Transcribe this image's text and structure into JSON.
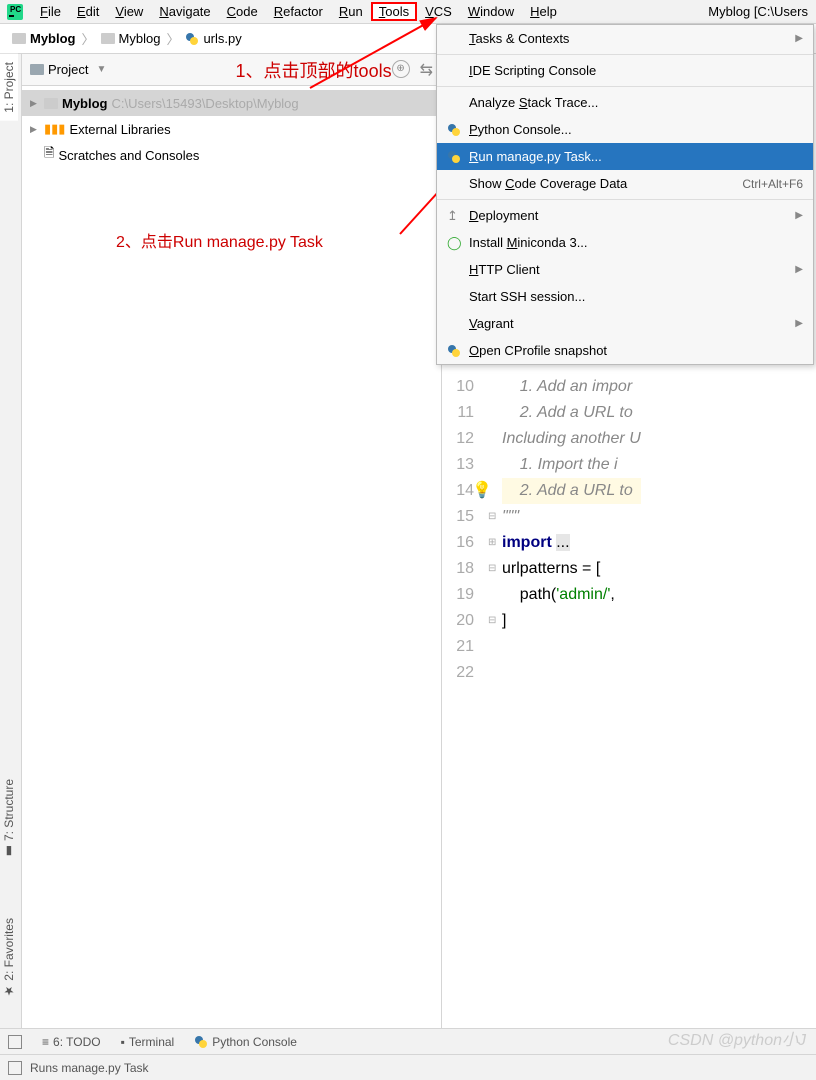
{
  "menubar": {
    "items": [
      "File",
      "Edit",
      "View",
      "Navigate",
      "Code",
      "Refactor",
      "Run",
      "Tools",
      "VCS",
      "Window",
      "Help"
    ],
    "right_title": "Myblog [C:\\Users"
  },
  "breadcrumb": {
    "items": [
      "Myblog",
      "Myblog",
      "urls.py"
    ]
  },
  "annotations": {
    "a1": "1、点击顶部的tools",
    "a2": "2、点击Run manage.py Task"
  },
  "project_panel": {
    "title": "Project",
    "tree": [
      {
        "label": "Myblog",
        "path": "C:\\Users\\15493\\Desktop\\Myblog",
        "selected": true,
        "arrow": "▶",
        "icon": "folder"
      },
      {
        "label": "External Libraries",
        "arrow": "▶",
        "icon": "lib"
      },
      {
        "label": "Scratches and Consoles",
        "arrow": "",
        "icon": "scratch"
      }
    ]
  },
  "dropdown": {
    "items": [
      {
        "label": "Tasks & Contexts",
        "u": "T",
        "type": "sub"
      },
      {
        "type": "sep"
      },
      {
        "label": "IDE Scripting Console",
        "u": "I"
      },
      {
        "type": "sep"
      },
      {
        "label": "Analyze Stack Trace...",
        "u": "S"
      },
      {
        "label": "Python Console...",
        "u": "P",
        "icon": "py"
      },
      {
        "label": "Run manage.py Task...",
        "u": "R",
        "icon": "py",
        "selected": true
      },
      {
        "label": "Show Code Coverage Data",
        "u": "C",
        "shortcut": "Ctrl+Alt+F6"
      },
      {
        "type": "sep"
      },
      {
        "label": "Deployment",
        "u": "D",
        "icon": "deploy",
        "type": "sub"
      },
      {
        "label": "Install Miniconda 3...",
        "u": "M",
        "icon": "conda"
      },
      {
        "label": "HTTP Client",
        "u": "H",
        "type": "sub"
      },
      {
        "label": "Start SSH session..."
      },
      {
        "label": "Vagrant",
        "u": "V",
        "type": "sub"
      },
      {
        "label": "Open CProfile snapshot",
        "u": "O",
        "icon": "py"
      }
    ]
  },
  "editor": {
    "lines": [
      {
        "n": "10",
        "text": "    1. Add an impor",
        "cls": "c-italic"
      },
      {
        "n": "11",
        "text": "    2. Add a URL to",
        "cls": "c-italic"
      },
      {
        "n": "12",
        "text": "Including another U",
        "cls": "c-italic"
      },
      {
        "n": "13",
        "text": "    1. Import the i",
        "cls": "c-italic"
      },
      {
        "n": "14",
        "text": "    2. Add a URL to",
        "cls": "c-italic",
        "bulb": true,
        "hl": true
      },
      {
        "n": "15",
        "text": "\"\"\"",
        "cls": "c-italic",
        "fold": "-"
      },
      {
        "n": "16",
        "html": "<span class='c-kw'>import</span> <span class='c-hl'>...</span>",
        "fold": "+"
      },
      {
        "n": "18",
        "text": ""
      },
      {
        "n": "19",
        "html": "urlpatterns = [",
        "fold": "-"
      },
      {
        "n": "20",
        "html": "    path(<span class='c-str'>'admin/'</span>,"
      },
      {
        "n": "21",
        "text": "]",
        "fold": "-"
      },
      {
        "n": "22",
        "text": ""
      }
    ]
  },
  "side_tabs": {
    "left_top": "1: Project",
    "left_bottom1": "7: Structure",
    "left_bottom2": "2: Favorites"
  },
  "bottom_bar": {
    "items": [
      "6: TODO",
      "Terminal",
      "Python Console"
    ]
  },
  "status_bar": {
    "text": "Runs manage.py Task"
  },
  "watermark": "CSDN @python小J"
}
